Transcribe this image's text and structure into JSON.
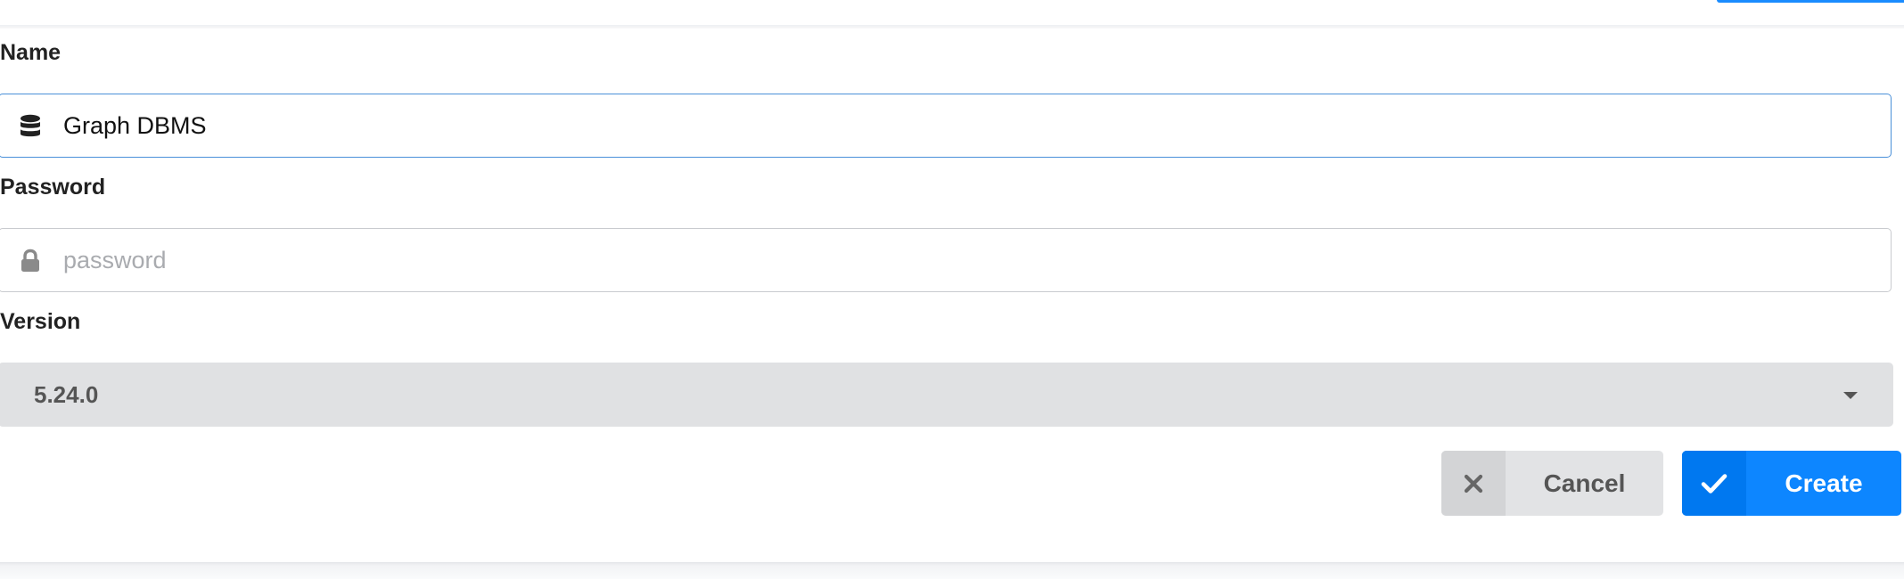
{
  "form": {
    "name": {
      "label": "Name",
      "value": "Graph DBMS",
      "icon": "database-icon"
    },
    "password": {
      "label": "Password",
      "value": "",
      "placeholder": "password",
      "icon": "lock-icon"
    },
    "version": {
      "label": "Version",
      "selected": "5.24.0"
    }
  },
  "actions": {
    "cancel_label": "Cancel",
    "cancel_icon": "close-icon",
    "create_label": "Create",
    "create_icon": "check-icon"
  },
  "colors": {
    "primary": "#0d86ff",
    "focus_border": "#4a90d9",
    "secondary_button": "#e2e3e5",
    "select_background": "#e0e1e3"
  }
}
